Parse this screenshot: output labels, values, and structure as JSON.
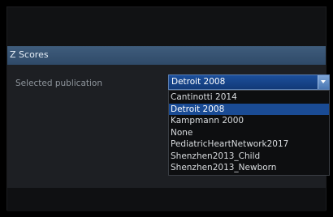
{
  "dialog": {
    "title": "Z Scores"
  },
  "form": {
    "label": "Selected publication",
    "selected_value": "Detroit 2008",
    "options": [
      "Cantinotti 2014",
      "Detroit 2008",
      "Kampmann 2000",
      "None",
      "PediatricHeartNetwork2017",
      "Shenzhen2013_Child",
      "Shenzhen2013_Newborn"
    ],
    "highlighted_index": 1
  },
  "colors": {
    "title_bar": "#3f5c7c",
    "selection": "#1a4b94",
    "panel": "#1d1f23"
  }
}
